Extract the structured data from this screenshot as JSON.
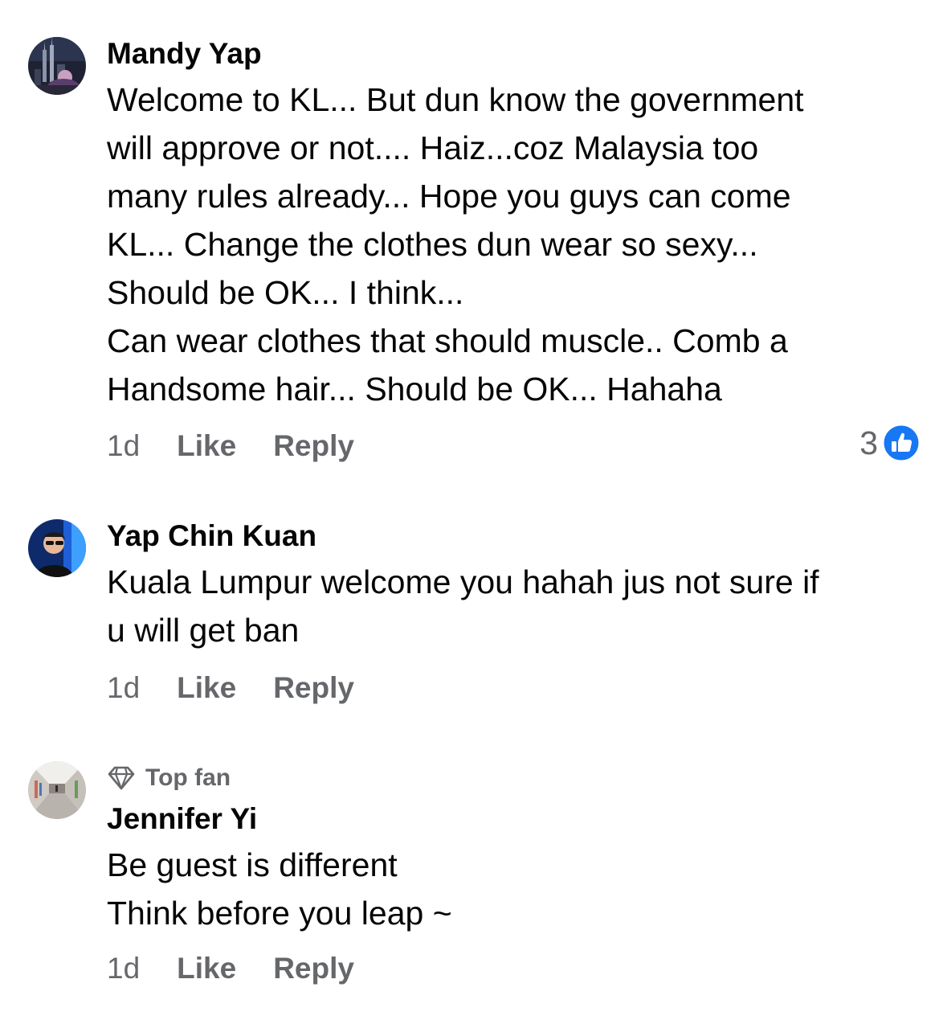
{
  "comments": [
    {
      "author": "Mandy Yap",
      "avatar_icon": "avatar-city-night",
      "lines": [
        "Welcome to KL... But dun know the government",
        "will approve or not.... Haiz...coz Malaysia too",
        "many rules already... Hope you guys can come",
        "KL... Change the clothes dun wear so sexy...",
        "Should be OK... I think...",
        "Can wear clothes that should muscle.. Comb a",
        "Handsome hair... Should be OK... Hahaha"
      ],
      "time": "1d",
      "like_label": "Like",
      "reply_label": "Reply",
      "reaction_count": "3",
      "reaction_icon": "like-thumb-icon"
    },
    {
      "author": "Yap Chin Kuan",
      "avatar_icon": "avatar-man-blue",
      "lines": [
        "Kuala Lumpur welcome you hahah jus not sure if",
        "u will get ban"
      ],
      "time": "1d",
      "like_label": "Like",
      "reply_label": "Reply"
    },
    {
      "author": "Jennifer Yi",
      "avatar_icon": "avatar-hallway",
      "badge_label": "Top fan",
      "badge_icon": "diamond-icon",
      "lines": [
        "Be guest is different",
        "Think before you leap ~"
      ],
      "time": "1d",
      "like_label": "Like",
      "reply_label": "Reply"
    }
  ],
  "colors": {
    "text": "#050505",
    "secondary": "#65676b",
    "like_blue": "#1877f2"
  }
}
